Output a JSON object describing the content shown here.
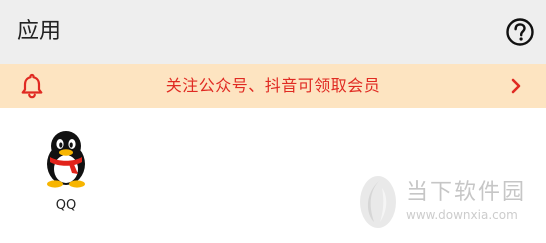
{
  "header": {
    "title": "应用",
    "help_icon": "help-circle-icon"
  },
  "notice": {
    "icon": "bell-icon",
    "text": "关注公众号、抖音可领取会员",
    "arrow_icon": "chevron-right-icon",
    "text_color": "#e02a22",
    "background": "#fde4c1"
  },
  "apps": [
    {
      "label": "QQ",
      "icon": "qq-penguin-icon"
    }
  ],
  "watermark": {
    "name": "当下软件园",
    "url": "www.downxia.com"
  }
}
